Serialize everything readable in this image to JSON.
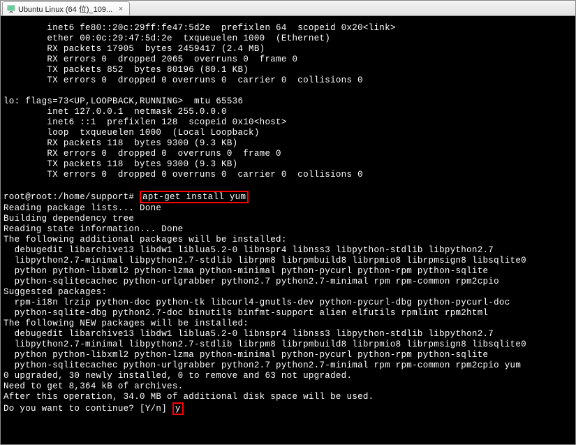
{
  "tab": {
    "title": "Ubuntu Linux (64 位)_109...",
    "close_glyph": "×"
  },
  "terminal": {
    "ifconfig_eth": [
      "        inet6 fe80::20c:29ff:fe47:5d2e  prefixlen 64  scopeid 0x20<link>",
      "        ether 00:0c:29:47:5d:2e  txqueuelen 1000  (Ethernet)",
      "        RX packets 17905  bytes 2459417 (2.4 MB)",
      "        RX errors 0  dropped 2065  overruns 0  frame 0",
      "        TX packets 852  bytes 80196 (80.1 KB)",
      "        TX errors 0  dropped 0 overruns 0  carrier 0  collisions 0",
      "",
      "lo: flags=73<UP,LOOPBACK,RUNNING>  mtu 65536",
      "        inet 127.0.0.1  netmask 255.0.0.0",
      "        inet6 ::1  prefixlen 128  scopeid 0x10<host>",
      "        loop  txqueuelen 1000  (Local Loopback)",
      "        RX packets 118  bytes 9300 (9.3 KB)",
      "        RX errors 0  dropped 0  overruns 0  frame 0",
      "        TX packets 118  bytes 9300 (9.3 KB)",
      "        TX errors 0  dropped 0 overruns 0  carrier 0  collisions 0",
      ""
    ],
    "prompt_prefix": "root@root:/home/support# ",
    "command": "apt-get install yum",
    "apt_output": [
      "Reading package lists... Done",
      "Building dependency tree",
      "Reading state information... Done",
      "The following additional packages will be installed:",
      "  debugedit libarchive13 libdw1 liblua5.2-0 libnspr4 libnss3 libpython-stdlib libpython2.7",
      "  libpython2.7-minimal libpython2.7-stdlib librpm8 librpmbuild8 librpmio8 librpmsign8 libsqlite0",
      "  python python-libxml2 python-lzma python-minimal python-pycurl python-rpm python-sqlite",
      "  python-sqlitecachec python-urlgrabber python2.7 python2.7-minimal rpm rpm-common rpm2cpio",
      "Suggested packages:",
      "  rpm-i18n lrzip python-doc python-tk libcurl4-gnutls-dev python-pycurl-dbg python-pycurl-doc",
      "  python-sqlite-dbg python2.7-doc binutils binfmt-support alien elfutils rpmlint rpm2html",
      "The following NEW packages will be installed:",
      "  debugedit libarchive13 libdw1 liblua5.2-0 libnspr4 libnss3 libpython-stdlib libpython2.7",
      "  libpython2.7-minimal libpython2.7-stdlib librpm8 librpmbuild8 librpmio8 librpmsign8 libsqlite0",
      "  python python-libxml2 python-lzma python-minimal python-pycurl python-rpm python-sqlite",
      "  python-sqlitecachec python-urlgrabber python2.7 python2.7-minimal rpm rpm-common rpm2cpio yum",
      "0 upgraded, 30 newly installed, 0 to remove and 63 not upgraded.",
      "Need to get 8,364 kB of archives.",
      "After this operation, 34.0 MB of additional disk space will be used."
    ],
    "continue_prompt": "Do you want to continue? [Y/n] ",
    "continue_answer": "y"
  }
}
